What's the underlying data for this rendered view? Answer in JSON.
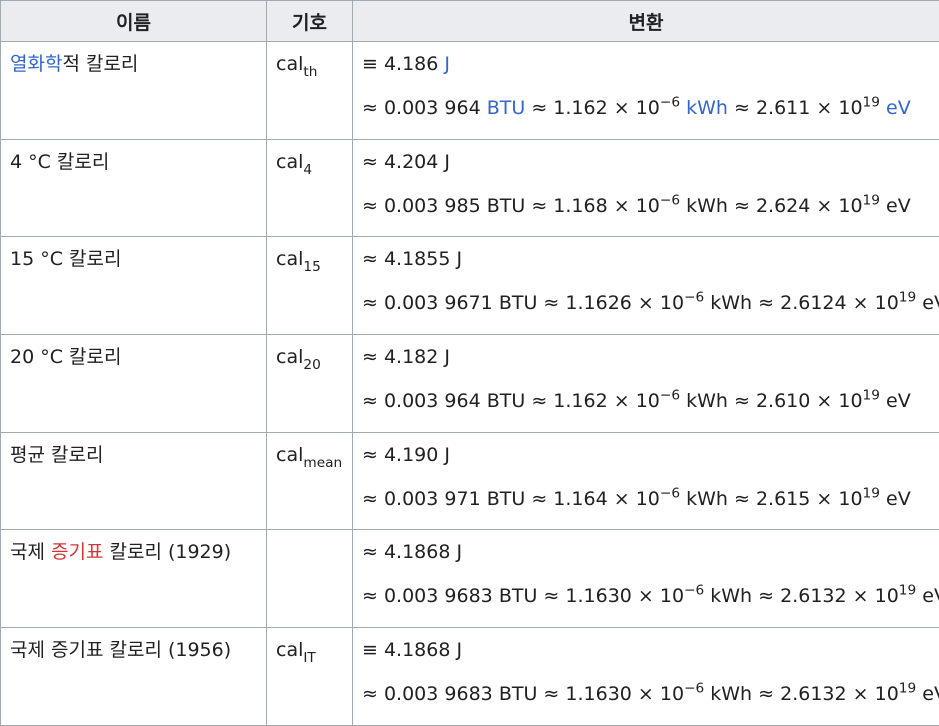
{
  "headers": {
    "name": "이름",
    "symbol": "기호",
    "conversion": "변환"
  },
  "rows": [
    {
      "name_link": "열화학",
      "name_rest": "적 칼로리",
      "symbol_base": "cal",
      "symbol_sub": "th",
      "line1_op": "≡",
      "line1_val": "4.186",
      "line1_unit": "J",
      "btu": "0.003 964",
      "kwh_mant": "1.162",
      "kwh_exp": "−6",
      "ev_mant": "2.611",
      "ev_exp": "19"
    },
    {
      "name": "4 °C 칼로리",
      "symbol_base": "cal",
      "symbol_sub": "4",
      "line1_op": "≈",
      "line1_val": "4.204",
      "line1_unit": "J",
      "btu": "0.003 985",
      "kwh_mant": "1.168",
      "kwh_exp": "−6",
      "ev_mant": "2.624",
      "ev_exp": "19"
    },
    {
      "name": "15 °C 칼로리",
      "symbol_base": "cal",
      "symbol_sub": "15",
      "line1_op": "≈",
      "line1_val": "4.1855",
      "line1_unit": "J",
      "btu": "0.003 9671",
      "kwh_mant": "1.1626",
      "kwh_exp": "−6",
      "ev_mant": "2.6124",
      "ev_exp": "19"
    },
    {
      "name": "20 °C 칼로리",
      "symbol_base": "cal",
      "symbol_sub": "20",
      "line1_op": "≈",
      "line1_val": "4.182",
      "line1_unit": "J",
      "btu": "0.003 964",
      "kwh_mant": "1.162",
      "kwh_exp": "−6",
      "ev_mant": "2.610",
      "ev_exp": "19"
    },
    {
      "name": "평균 칼로리",
      "symbol_base": "cal",
      "symbol_sub": "mean",
      "line1_op": "≈",
      "line1_val": "4.190",
      "line1_unit": "J",
      "btu": "0.003 971",
      "kwh_mant": "1.164",
      "kwh_exp": "−6",
      "ev_mant": "2.615",
      "ev_exp": "19"
    },
    {
      "name_pre": "국제 ",
      "name_redlink": "증기표",
      "name_post": " 칼로리 (1929)",
      "line1_op": "≈",
      "line1_val": "4.1868",
      "line1_unit": "J",
      "btu": "0.003 9683",
      "kwh_mant": "1.1630",
      "kwh_exp": "−6",
      "ev_mant": "2.6132",
      "ev_exp": "19"
    },
    {
      "name": "국제 증기표 칼로리 (1956)",
      "symbol_base": "cal",
      "symbol_sub": "IT",
      "line1_op": "≡",
      "line1_val": "4.1868",
      "line1_unit": "J",
      "btu": "0.003 9683",
      "kwh_mant": "1.1630",
      "kwh_exp": "−6",
      "ev_mant": "2.6132",
      "ev_exp": "19"
    }
  ],
  "units": {
    "btu": "BTU",
    "kwh": "kWh",
    "ev": "eV",
    "approx": "≈",
    "times_ten": "× 10"
  },
  "colors": {
    "link": "#3366cc",
    "redlink": "#d73333",
    "header_bg": "#eaecf0",
    "border": "#a2a9b1"
  }
}
